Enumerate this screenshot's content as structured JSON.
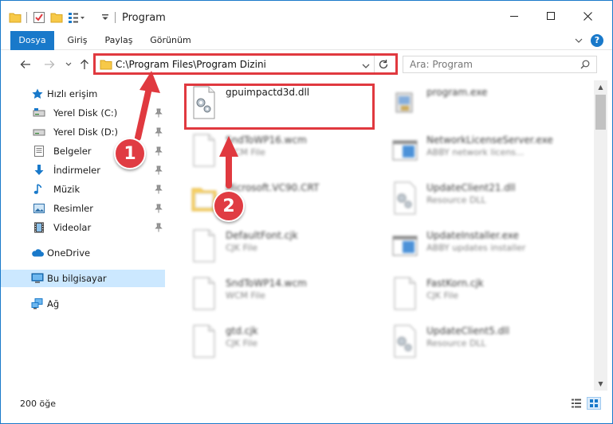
{
  "window": {
    "title": "Program",
    "accent": "#1979ca",
    "controls": {
      "minimize": "minimize-icon",
      "maximize": "maximize-icon",
      "close": "close-icon"
    }
  },
  "ribbon": {
    "tabs": [
      {
        "label": "Dosya"
      },
      {
        "label": "Giriş"
      },
      {
        "label": "Paylaş"
      },
      {
        "label": "Görünüm"
      }
    ]
  },
  "navigation": {
    "address": "C:\\Program Files\\Program Dizini",
    "search_placeholder": "Ara: Program"
  },
  "sidebar": {
    "quick_access": "Hızlı erişim",
    "items": [
      {
        "label": "Yerel Disk (C:)",
        "icon": "drive-icon",
        "pinned": true
      },
      {
        "label": "Yerel Disk (D:)",
        "icon": "drive-icon",
        "pinned": true
      },
      {
        "label": "Belgeler",
        "icon": "documents-icon",
        "pinned": true
      },
      {
        "label": "İndirmeler",
        "icon": "download-arrow-icon",
        "pinned": true
      },
      {
        "label": "Müzik",
        "icon": "music-note-icon",
        "pinned": true
      },
      {
        "label": "Resimler",
        "icon": "pictures-icon",
        "pinned": true
      },
      {
        "label": "Videolar",
        "icon": "film-icon",
        "pinned": true
      }
    ],
    "onedrive": "OneDrive",
    "this_pc": "Bu bilgisayar",
    "network": "Ağ"
  },
  "files": [
    {
      "name": "gpuimpactd3d.dll",
      "type": "",
      "icon": "dll-gear-icon",
      "highlighted": true
    },
    {
      "name": "program.exe",
      "type": "",
      "icon": "exe-app-icon"
    },
    {
      "name": "SndToWP16.wcm",
      "type": "WCM File",
      "icon": "blank-file-icon"
    },
    {
      "name": "NetworkLicenseServer.exe",
      "type": "ABBY network licens...",
      "icon": "exe-window-icon"
    },
    {
      "name": "Microsoft.VC90.CRT",
      "type": "",
      "icon": "folder-icon"
    },
    {
      "name": "UpdateClient21.dll",
      "type": "Resource DLL",
      "icon": "dll-gear-icon"
    },
    {
      "name": "DefaultFont.cjk",
      "type": "CJK File",
      "icon": "blank-file-icon"
    },
    {
      "name": "UpdateInstaller.exe",
      "type": "ABBY updates installer",
      "icon": "exe-window-icon"
    },
    {
      "name": "SndToWP14.wcm",
      "type": "WCM File",
      "icon": "blank-file-icon"
    },
    {
      "name": "FastKorn.cjk",
      "type": "CJK File",
      "icon": "blank-file-icon"
    },
    {
      "name": "gtd.cjk",
      "type": "CJK File",
      "icon": "blank-file-icon"
    },
    {
      "name": "UpdateClient5.dll",
      "type": "Resource DLL",
      "icon": "dll-gear-icon"
    }
  ],
  "status": {
    "count": "200 öğe"
  },
  "annotations": [
    {
      "label": "1",
      "color": "#e03c43"
    },
    {
      "label": "2",
      "color": "#e03c43"
    }
  ]
}
